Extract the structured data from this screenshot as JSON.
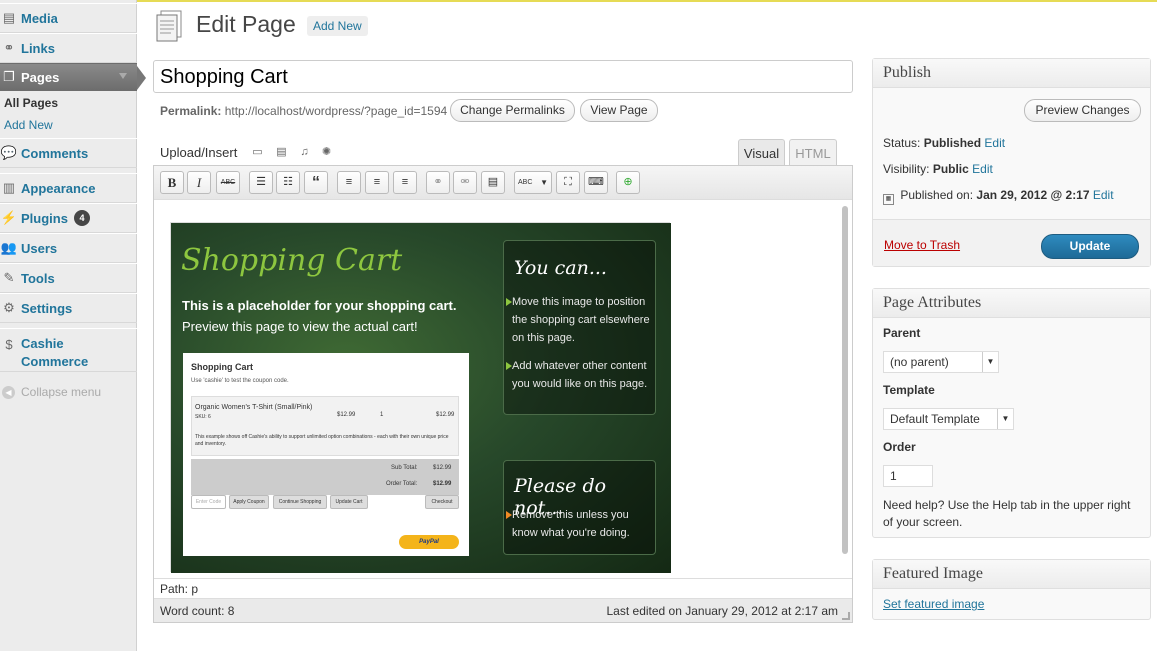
{
  "sidebar": {
    "items": [
      {
        "label": "Media",
        "icon": "media-icon"
      },
      {
        "label": "Links",
        "icon": "links-icon"
      },
      {
        "label": "Pages",
        "icon": "pages-icon"
      },
      {
        "label": "Comments",
        "icon": "comments-icon"
      },
      {
        "label": "Appearance",
        "icon": "appearance-icon"
      },
      {
        "label": "Plugins",
        "icon": "plugins-icon",
        "badge": "4"
      },
      {
        "label": "Users",
        "icon": "users-icon"
      },
      {
        "label": "Tools",
        "icon": "tools-icon"
      },
      {
        "label": "Settings",
        "icon": "settings-icon"
      },
      {
        "label_line1": "Cashie",
        "label_line2": "Commerce",
        "icon": "dollar-icon"
      }
    ],
    "submenu": {
      "all_pages": "All Pages",
      "add_new": "Add New"
    },
    "collapse": "Collapse menu"
  },
  "header": {
    "title": "Edit Page",
    "add_new": "Add New"
  },
  "editor": {
    "post_title": "Shopping Cart",
    "permalink_label": "Permalink:",
    "permalink_url": "http://localhost/wordpress/?page_id=1594",
    "change_permalinks": "Change Permalinks",
    "view_page": "View Page",
    "upload_insert": "Upload/Insert",
    "tab_visual": "Visual",
    "tab_html": "HTML",
    "toolbar": {
      "bold": "B",
      "italic": "I",
      "strike": "ABC",
      "quote": "“",
      "spell": "ABC"
    },
    "path": "Path: p",
    "word_count": "Word count: 8",
    "last_edited": "Last edited on January 29, 2012 at 2:17 am"
  },
  "cart_image": {
    "heading": "Shopping Cart",
    "desc_line1": "This is a placeholder for your shopping cart.",
    "desc_line2": "Preview this page to view the actual cart!",
    "you_can": "You can...",
    "you_can_items": [
      {
        "l1": "Move this image to position",
        "l2": "the shopping cart elsewhere",
        "l3": "on this page."
      },
      {
        "l1": "Add whatever other content",
        "l2": "you would like on this page."
      }
    ],
    "please_do_not": "Please do not...",
    "do_not_items": [
      {
        "l1": "Remove this unless you",
        "l2": "know what you're doing."
      }
    ],
    "mini": {
      "title": "Shopping Cart",
      "subtitle": "Use 'cashie' to test the coupon code.",
      "product": "Organic Women's T-Shirt (Small/Pink)",
      "sku": "SKU: 6",
      "price": "$12.99",
      "qty": "1",
      "total": "$12.99",
      "note": "This example shows off Cashie's ability to support unlimited option combinations - each with their own unique price and inventory.",
      "subtotal_label": "Sub Total:",
      "subtotal": "$12.99",
      "ordertotal_label": "Order Total:",
      "ordertotal": "$12.99",
      "coupon_placeholder": "Enter Code",
      "apply": "Apply Coupon",
      "continue": "Continue Shopping",
      "update": "Update Cart",
      "checkout": "Checkout",
      "paypal": "PayPal"
    }
  },
  "publish": {
    "title": "Publish",
    "preview": "Preview Changes",
    "status_label": "Status:",
    "status_value": "Published",
    "visibility_label": "Visibility:",
    "visibility_value": "Public",
    "published_label": "Published on:",
    "published_value": "Jan 29, 2012 @ 2:17",
    "edit": "Edit",
    "trash": "Move to Trash",
    "update": "Update"
  },
  "attributes": {
    "title": "Page Attributes",
    "parent_label": "Parent",
    "parent_value": "(no parent)",
    "template_label": "Template",
    "template_value": "Default Template",
    "order_label": "Order",
    "order_value": "1",
    "help_line1": "Need help? Use the Help tab in the upper right",
    "help_line2": "of your screen."
  },
  "featured": {
    "title": "Featured Image",
    "link": "Set featured image"
  }
}
